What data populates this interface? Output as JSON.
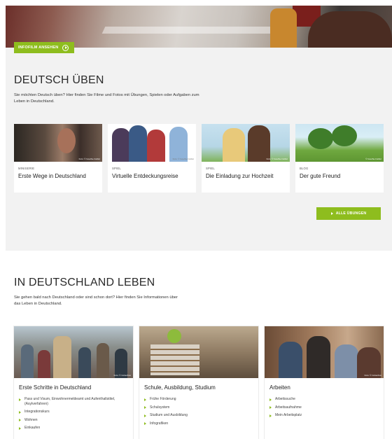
{
  "hero": {
    "infofilm_label": "INFOFILM ANSEHEN"
  },
  "practice": {
    "title": "DEUTSCH ÜBEN",
    "intro": "Sie möchten Deutsch üben? Hier finden Sie Filme und Fotos mit Übungen, Spielen oder Aufgaben zum Leben in Deutschland.",
    "cards": [
      {
        "kicker": "MINISERIE",
        "title": "Erste Wege in Deutschland",
        "credit": "Foto: © Goethe-Institut"
      },
      {
        "kicker": "SPIEL",
        "title": "Virtuelle Entdeckungsreise",
        "credit": "Foto: © Goethe-Institut"
      },
      {
        "kicker": "SPIEL",
        "title": "Die Einladung zur Hochzeit",
        "credit": "Foto: © Goethe-Institut"
      },
      {
        "kicker": "BLOG",
        "title": "Der gute Freund",
        "credit": "© Goethe-Institut"
      }
    ],
    "all_label": "ALLE ÜBUNGEN"
  },
  "leben": {
    "title": "IN DEUTSCHLAND LEBEN",
    "intro": "Sie gehen bald nach Deutschland oder sind schon dort? Hier finden Sie Informationen über das Leben in Deutschland.",
    "cards": [
      {
        "title": "Erste Schritte in Deutschland",
        "credit": "Foto: © Colourbox",
        "links": [
          "Pass und Visum, Einwohnermeldeamt und Aufenthaltstitel, (Asylverfahren)",
          "Integrationskurs",
          "Wohnen",
          "Einkaufen"
        ]
      },
      {
        "title": "Schule, Ausbildung, Studium",
        "credit": "",
        "links": [
          "Frühe Förderung",
          "Schulsystem",
          "Studium und Ausbildung",
          "Infografiken"
        ]
      },
      {
        "title": "Arbeiten",
        "credit": "Foto: © Colourbox",
        "links": [
          "Arbeitssuche",
          "Arbeitsaufnahme",
          "Mein Arbeitsplatz"
        ]
      }
    ]
  },
  "colors": {
    "accent": "#8ebd1e",
    "section_bg": "#f2f2f2"
  }
}
